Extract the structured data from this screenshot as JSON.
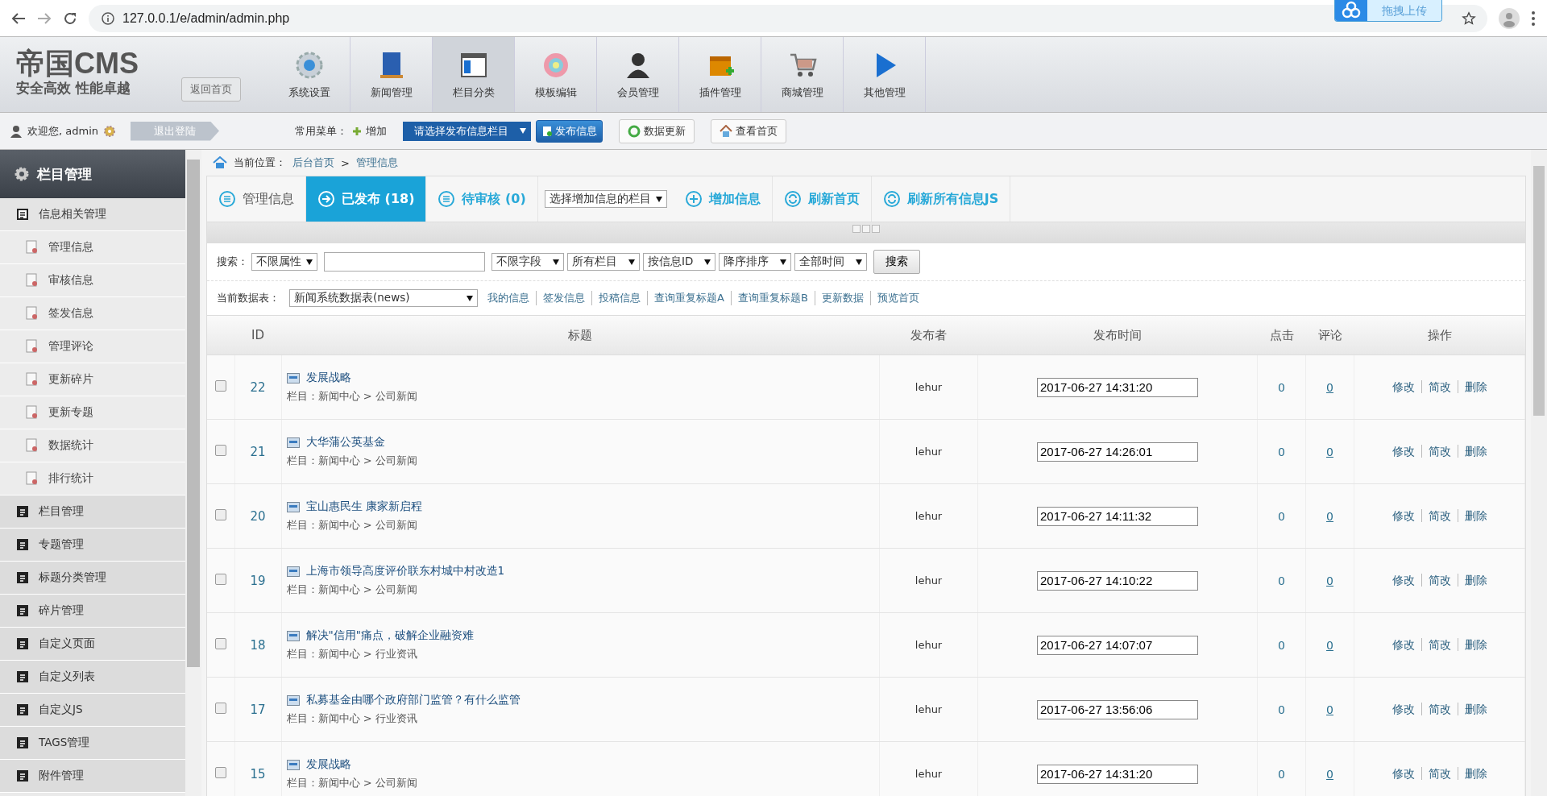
{
  "browser": {
    "url": "127.0.0.1/e/admin/admin.php",
    "upload_badge": "拖拽上传"
  },
  "header": {
    "logo_title": "帝国CMS",
    "logo_slogan": "安全高效 性能卓越",
    "back_button": "返回首页",
    "nav": [
      {
        "label": "系统设置",
        "selected": false
      },
      {
        "label": "新闻管理",
        "selected": false
      },
      {
        "label": "栏目分类",
        "selected": true
      },
      {
        "label": "模板编辑",
        "selected": false
      },
      {
        "label": "会员管理",
        "selected": false
      },
      {
        "label": "插件管理",
        "selected": false
      },
      {
        "label": "商城管理",
        "selected": false
      },
      {
        "label": "其他管理",
        "selected": false
      }
    ]
  },
  "toolbar": {
    "welcome": "欢迎您, admin",
    "logout": "退出登陆",
    "common_menu_label": "常用菜单：",
    "add": "增加",
    "column_select": "请选择发布信息栏目",
    "publish": "发布信息",
    "buttons": [
      "数据更新",
      "查看首页"
    ]
  },
  "sidebar": {
    "title": "栏目管理",
    "groups": [
      {
        "label": "信息相关管理",
        "expanded": true,
        "children": [
          {
            "label": "管理信息"
          },
          {
            "label": "审核信息"
          },
          {
            "label": "签发信息"
          },
          {
            "label": "管理评论"
          },
          {
            "label": "更新碎片"
          },
          {
            "label": "更新专题"
          },
          {
            "label": "数据统计"
          },
          {
            "label": "排行统计"
          }
        ]
      },
      {
        "label": "栏目管理",
        "expanded": false
      },
      {
        "label": "专题管理",
        "expanded": false
      },
      {
        "label": "标题分类管理",
        "expanded": false
      },
      {
        "label": "碎片管理",
        "expanded": false
      },
      {
        "label": "自定义页面",
        "expanded": false
      },
      {
        "label": "自定义列表",
        "expanded": false
      },
      {
        "label": "自定义JS",
        "expanded": false
      },
      {
        "label": "TAGS管理",
        "expanded": false
      },
      {
        "label": "附件管理",
        "expanded": false
      }
    ]
  },
  "breadcrumb": {
    "label": "当前位置：",
    "items": [
      "后台首页",
      "管理信息"
    ],
    "separator": ">"
  },
  "tabs": [
    {
      "label": "管理信息",
      "selected": false
    },
    {
      "label": "已发布 (18)",
      "selected": true
    },
    {
      "label": "待审核 (0)",
      "selected": false
    }
  ],
  "add_column_select": "选择增加信息的栏目",
  "actions": [
    "增加信息",
    "刷新首页",
    "刷新所有信息JS"
  ],
  "search": {
    "label": "搜索：",
    "attribute_select": "不限属性",
    "selects": [
      "不限字段",
      "所有栏目",
      "按信息ID",
      "降序排序",
      "全部时间"
    ],
    "button": "搜索"
  },
  "data_table": {
    "label": "当前数据表：",
    "value": "新闻系统数据表(news)",
    "links": [
      "我的信息",
      "签发信息",
      "投稿信息",
      "查询重复标题A",
      "查询重复标题B",
      "更新数据",
      "预览首页"
    ]
  },
  "table": {
    "columns": [
      "ID",
      "标题",
      "发布者",
      "发布时间",
      "点击",
      "评论",
      "操作"
    ],
    "rows": [
      {
        "checked": false,
        "id": "22",
        "title": "发展战略",
        "category": "栏目：新闻中心 > 公司新闻",
        "publisher": "lehur",
        "time": "2017-06-27 14:31:20",
        "clicks": "0",
        "comments": "0",
        "ops": [
          "修改",
          "简改",
          "删除"
        ]
      },
      {
        "checked": false,
        "id": "21",
        "title": "大华蒲公英基金",
        "category": "栏目：新闻中心 > 公司新闻",
        "publisher": "lehur",
        "time": "2017-06-27 14:26:01",
        "clicks": "0",
        "comments": "0",
        "ops": [
          "修改",
          "简改",
          "删除"
        ]
      },
      {
        "checked": false,
        "id": "20",
        "title": "宝山惠民生 康家新启程",
        "category": "栏目：新闻中心 > 公司新闻",
        "publisher": "lehur",
        "time": "2017-06-27 14:11:32",
        "clicks": "0",
        "comments": "0",
        "ops": [
          "修改",
          "简改",
          "删除"
        ]
      },
      {
        "checked": false,
        "id": "19",
        "title": "上海市领导高度评价联东村城中村改造1",
        "category": "栏目：新闻中心 > 公司新闻",
        "publisher": "lehur",
        "time": "2017-06-27 14:10:22",
        "clicks": "0",
        "comments": "0",
        "ops": [
          "修改",
          "简改",
          "删除"
        ]
      },
      {
        "checked": false,
        "id": "18",
        "title": "解决\"信用\"痛点，破解企业融资难",
        "category": "栏目：新闻中心 > 行业资讯",
        "publisher": "lehur",
        "time": "2017-06-27 14:07:07",
        "clicks": "0",
        "comments": "0",
        "ops": [
          "修改",
          "简改",
          "删除"
        ]
      },
      {
        "checked": false,
        "id": "17",
        "title": "私募基金由哪个政府部门监管？有什么监管",
        "category": "栏目：新闻中心 > 行业资讯",
        "publisher": "lehur",
        "time": "2017-06-27 13:56:06",
        "clicks": "0",
        "comments": "0",
        "ops": [
          "修改",
          "简改",
          "删除"
        ]
      },
      {
        "checked": false,
        "id": "15",
        "title": "发展战略",
        "category": "栏目：新闻中心 > 公司新闻",
        "publisher": "lehur",
        "time": "2017-06-27 14:31:20",
        "clicks": "0",
        "comments": "0",
        "ops": [
          "修改",
          "简改",
          "删除"
        ]
      }
    ]
  }
}
